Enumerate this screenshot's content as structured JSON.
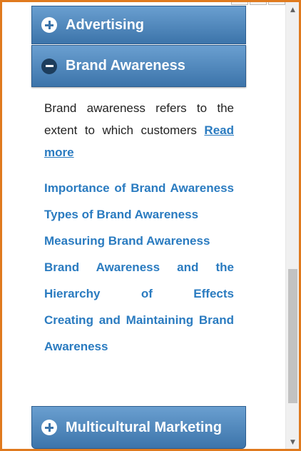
{
  "accordion": {
    "advertising": {
      "label": "Advertising",
      "state": "collapsed"
    },
    "brand_awareness": {
      "label": "Brand Awareness",
      "state": "expanded"
    },
    "multicultural": {
      "label": "Multicultural Marketing",
      "state": "collapsed"
    }
  },
  "brand_section": {
    "description": "Brand awareness refers to the extent to which customers",
    "read_more": "Read more",
    "links": [
      "Importance of Brand Awareness",
      "Types of Brand Awareness",
      "Measuring Brand Awareness",
      "Brand Awareness and the Hierarchy of Effects",
      "Creating and Maintaining Brand Awareness"
    ]
  },
  "scrollbar": {
    "up_arrow": "▲",
    "down_arrow": "▼"
  },
  "colors": {
    "frame": "#e07a1e",
    "header": "#3c74aa",
    "link": "#2a7bc0"
  }
}
